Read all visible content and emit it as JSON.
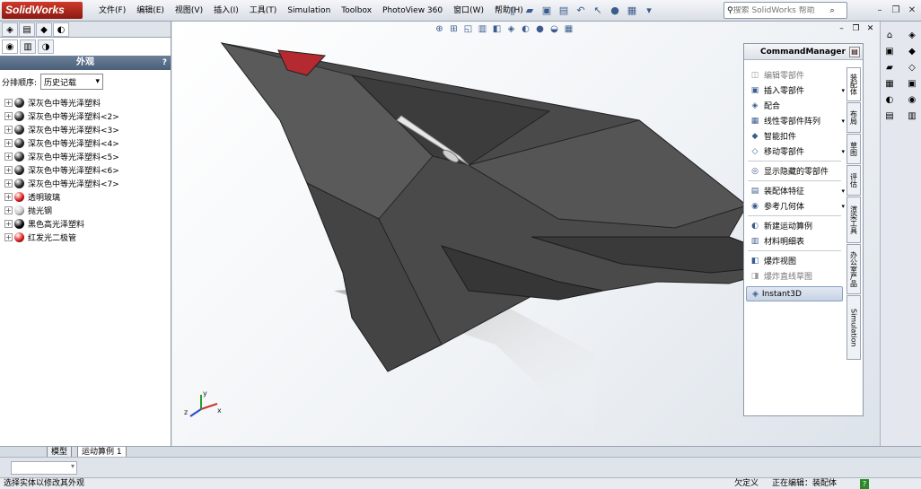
{
  "app": {
    "logo_text": "SolidWorks"
  },
  "menu": [
    "文件(F)",
    "编辑(E)",
    "视图(V)",
    "插入(I)",
    "工具(T)",
    "Simulation",
    "Toolbox",
    "PhotoView 360",
    "窗口(W)",
    "帮助(H)"
  ],
  "help_search": {
    "placeholder": "搜索 SolidWorks 帮助"
  },
  "left_panel": {
    "header": "外观",
    "help_mark": "?",
    "sort_label": "分排顺序:",
    "sort_value": "历史记载",
    "items": [
      {
        "label": "深灰色中等光泽塑料",
        "color": "#2a2a2a"
      },
      {
        "label": "深灰色中等光泽塑料<2>",
        "color": "#2a2a2a"
      },
      {
        "label": "深灰色中等光泽塑料<3>",
        "color": "#2a2a2a"
      },
      {
        "label": "深灰色中等光泽塑料<4>",
        "color": "#2a2a2a"
      },
      {
        "label": "深灰色中等光泽塑料<5>",
        "color": "#2a2a2a"
      },
      {
        "label": "深灰色中等光泽塑料<6>",
        "color": "#2a2a2a"
      },
      {
        "label": "深灰色中等光泽塑料<7>",
        "color": "#2a2a2a"
      },
      {
        "label": "透明玻璃",
        "color": "#e02020"
      },
      {
        "label": "抛光钢",
        "color": "#c8c8c8"
      },
      {
        "label": "黑色高光泽塑料",
        "color": "#050505"
      },
      {
        "label": "红发光二极管",
        "color": "#e02020"
      }
    ]
  },
  "command_manager": {
    "title": "CommandManager",
    "items": [
      {
        "label": "编辑零部件",
        "dim": true,
        "dropdown": false
      },
      {
        "label": "插入零部件",
        "dim": false,
        "dropdown": true
      },
      {
        "label": "配合",
        "dim": false,
        "dropdown": false
      },
      {
        "label": "线性零部件阵列",
        "dim": false,
        "dropdown": true
      },
      {
        "label": "智能扣件",
        "dim": false,
        "dropdown": false
      },
      {
        "label": "移动零部件",
        "dim": false,
        "dropdown": true
      },
      {
        "label": "显示隐藏的零部件",
        "dim": false,
        "dropdown": false
      },
      {
        "label": "装配体特征",
        "dim": false,
        "dropdown": true
      },
      {
        "label": "参考几何体",
        "dim": false,
        "dropdown": true
      },
      {
        "label": "新建运动算例",
        "dim": false,
        "dropdown": false
      },
      {
        "label": "材料明细表",
        "dim": false,
        "dropdown": false
      },
      {
        "label": "爆炸视图",
        "dim": false,
        "dropdown": false
      },
      {
        "label": "爆炸直线草图",
        "dim": true,
        "dropdown": false
      }
    ],
    "instant3d": "Instant3D",
    "tabs": [
      "装配体",
      "布局",
      "草图",
      "评估",
      "渲染工具",
      "办公室产品",
      "Simulation"
    ]
  },
  "bottom_tabs": [
    "模型",
    "运动算例 1"
  ],
  "status": {
    "left": "选择实体以修改其外观",
    "underdefined": "欠定义",
    "editing": "正在编辑：装配体",
    "help_mark": "?"
  },
  "triad": {
    "x": "x",
    "y": "y",
    "z": "z"
  },
  "colors": {
    "accent": "#4a5f7a",
    "aircraft": "#4a4a4a",
    "cockpit": "#b52a30"
  }
}
